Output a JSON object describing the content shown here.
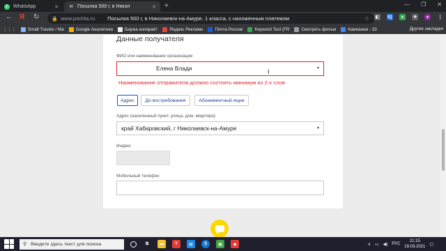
{
  "browser": {
    "tabs": [
      {
        "label": "WhatsApp",
        "icon": "whatsapp-icon"
      },
      {
        "label": "Посылка 500 г, в Никол",
        "icon": "pochta-icon"
      }
    ],
    "url": "www.pochta.ru",
    "page_heading": "Посылка 500 г, в Николаевск-на-Амуре, 1 класса, с наложенным платежом",
    "bookmarks": [
      {
        "label": "Small Travels / Ма",
        "color": "#8ab4f8"
      },
      {
        "label": "Google Аналитика",
        "color": "#f9ab00"
      },
      {
        "label": "Биржа копирайт",
        "color": "#e8eaed"
      },
      {
        "label": "Яндекс Рекламн",
        "color": "#ea4335"
      },
      {
        "label": "Почта России",
        "color": "#1a5dd6"
      },
      {
        "label": "Keyword Tool (FR",
        "color": "#34a853"
      },
      {
        "label": "Смотреть фильм",
        "color": "#9aa0a6"
      },
      {
        "label": "Кампании - 33",
        "color": "#4285f4"
      }
    ],
    "bookmarks_more": "Другие закладки"
  },
  "form": {
    "section_title": "Данные получателя",
    "name_label": "ФИО или наименование организации",
    "name_value": "Елена Влади",
    "name_error": "Наименование отправителя должно состоять минимум из 2-х слов",
    "delivery_options": [
      "Адрес",
      "До востребования",
      "Абонементный ящик"
    ],
    "address_label": "Адрес (населенный пункт, улица, дом, квартира)",
    "address_value": "край Хабаровский, г Николаевск-на-Амуре",
    "index_label": "Индекс",
    "index_value": "",
    "phone_label": "Мобильный телефон",
    "phone_value": ""
  },
  "taskbar": {
    "search_placeholder": "Введите здесь текст для поиска",
    "language": "РУС",
    "time": "21:15",
    "date": "19.03.2021"
  }
}
